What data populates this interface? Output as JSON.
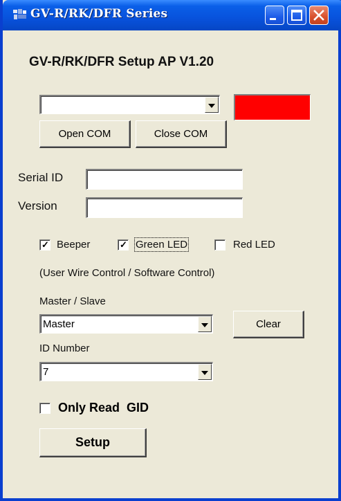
{
  "window": {
    "title": "GV-R/RK/DFR Series",
    "heading": "GV-R/RK/DFR Setup AP   V1.20"
  },
  "com": {
    "selected_port": "",
    "open_label": "Open COM",
    "close_label": "Close COM",
    "status_color": "#FF0000"
  },
  "info": {
    "serial_id_label": "Serial ID",
    "serial_id_value": "",
    "version_label": "Version",
    "version_value": ""
  },
  "options": {
    "beeper": {
      "label": "Beeper",
      "checked": true
    },
    "green_led": {
      "label": "Green LED",
      "checked": true
    },
    "red_led": {
      "label": "Red LED",
      "checked": false
    },
    "note": "(User Wire Control / Software Control)"
  },
  "master_slave": {
    "label": "Master / Slave",
    "selected": "Master",
    "clear_label": "Clear"
  },
  "id_number": {
    "label": "ID Number",
    "selected": "7"
  },
  "only_read": {
    "label": "Only Read  GID",
    "checked": false
  },
  "setup": {
    "label": "Setup"
  }
}
